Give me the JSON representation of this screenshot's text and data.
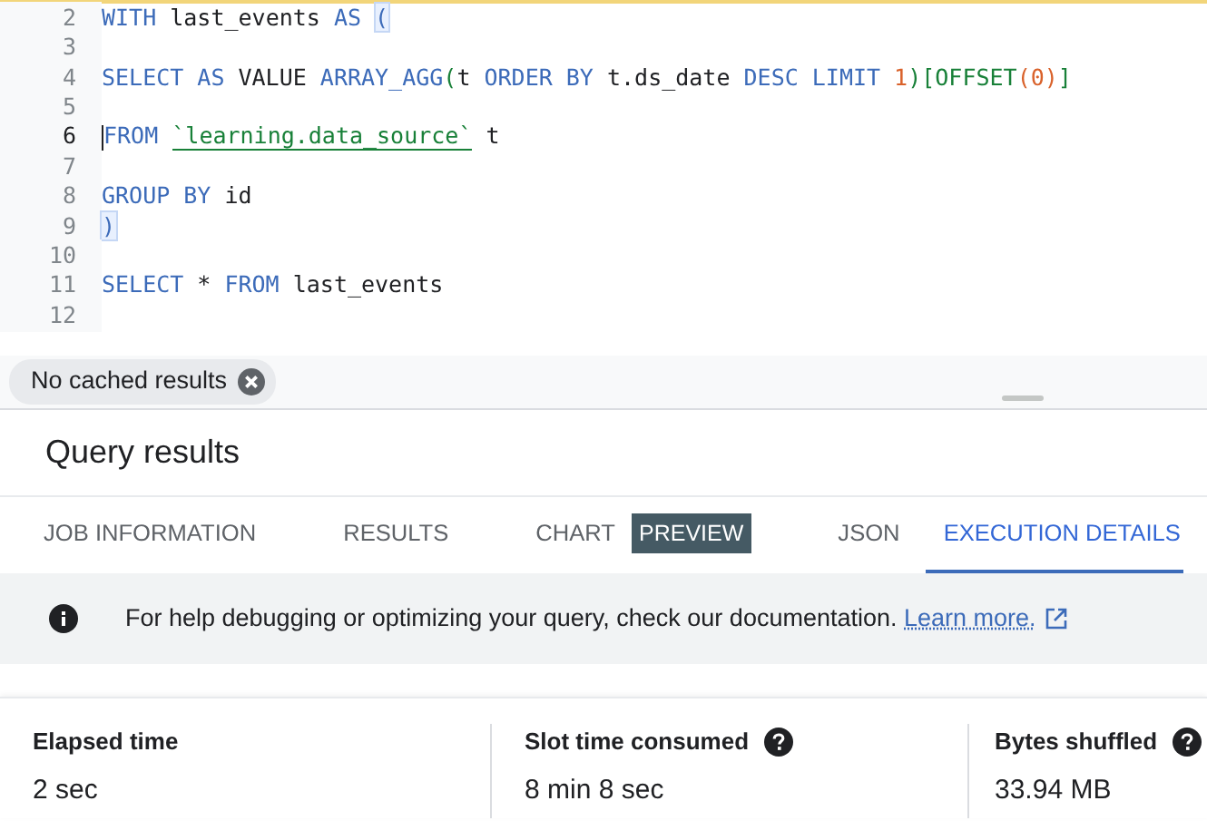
{
  "editor": {
    "lines": [
      {
        "number": "2",
        "current": false,
        "tokens": [
          {
            "text": "WITH",
            "kind": "kw"
          },
          {
            "text": " last_events ",
            "kind": "plain"
          },
          {
            "text": "AS ",
            "kind": "kw"
          },
          {
            "text": "(",
            "kind": "match"
          }
        ]
      },
      {
        "number": "3",
        "current": false
      },
      {
        "number": "4",
        "current": false,
        "tokens": [
          {
            "text": "SELECT AS",
            "kind": "kw"
          },
          {
            "text": " VALUE ",
            "kind": "plain"
          },
          {
            "text": "ARRAY_AGG",
            "kind": "kw"
          },
          {
            "text": "(",
            "kind": "paren"
          },
          {
            "text": "t ",
            "kind": "plain"
          },
          {
            "text": "ORDER BY",
            "kind": "kw"
          },
          {
            "text": " t.ds_date ",
            "kind": "plain"
          },
          {
            "text": "DESC LIMIT",
            "kind": "kw"
          },
          {
            "text": " 1",
            "kind": "num"
          },
          {
            "text": ")[OFFSET",
            "kind": "paren"
          },
          {
            "text": "(0)",
            "kind": "num"
          },
          {
            "text": "]",
            "kind": "paren"
          }
        ]
      },
      {
        "number": "5",
        "current": false
      },
      {
        "number": "6",
        "current": true,
        "tokens": [
          {
            "text": "FROM ",
            "kind": "kw"
          },
          {
            "text": "`learning.data_source`",
            "kind": "str"
          },
          {
            "text": " t",
            "kind": "plain"
          }
        ]
      },
      {
        "number": "7",
        "current": false
      },
      {
        "number": "8",
        "current": false,
        "tokens": [
          {
            "text": "GROUP BY",
            "kind": "kw"
          },
          {
            "text": " id",
            "kind": "plain"
          }
        ]
      },
      {
        "number": "9",
        "current": false,
        "tokens": [
          {
            "text": ")",
            "kind": "match"
          }
        ]
      },
      {
        "number": "10",
        "current": false
      },
      {
        "number": "11",
        "current": false,
        "tokens": [
          {
            "text": "SELECT",
            "kind": "kw"
          },
          {
            "text": " * ",
            "kind": "plain"
          },
          {
            "text": "FROM",
            "kind": "kw"
          },
          {
            "text": " last_events",
            "kind": "plain"
          }
        ]
      },
      {
        "number": "12",
        "current": false
      }
    ]
  },
  "chip": {
    "label": "No cached results"
  },
  "results": {
    "title": "Query results",
    "tabs": [
      {
        "label": "JOB INFORMATION",
        "selected": false
      },
      {
        "label": "RESULTS",
        "selected": false
      },
      {
        "label": "CHART",
        "badge": "PREVIEW",
        "selected": false
      },
      {
        "label": "JSON",
        "selected": false
      },
      {
        "label": "EXECUTION DETAILS",
        "selected": true
      }
    ],
    "notice": {
      "text": "For help debugging or optimizing your query, check our documentation.",
      "link": "Learn more."
    },
    "stats": [
      {
        "label": "Elapsed time",
        "value": "2 sec",
        "help": false
      },
      {
        "label": "Slot time consumed",
        "value": "8 min 8 sec",
        "help": true
      },
      {
        "label": "Bytes shuffled",
        "value": "33.94 MB",
        "help": true
      }
    ]
  }
}
